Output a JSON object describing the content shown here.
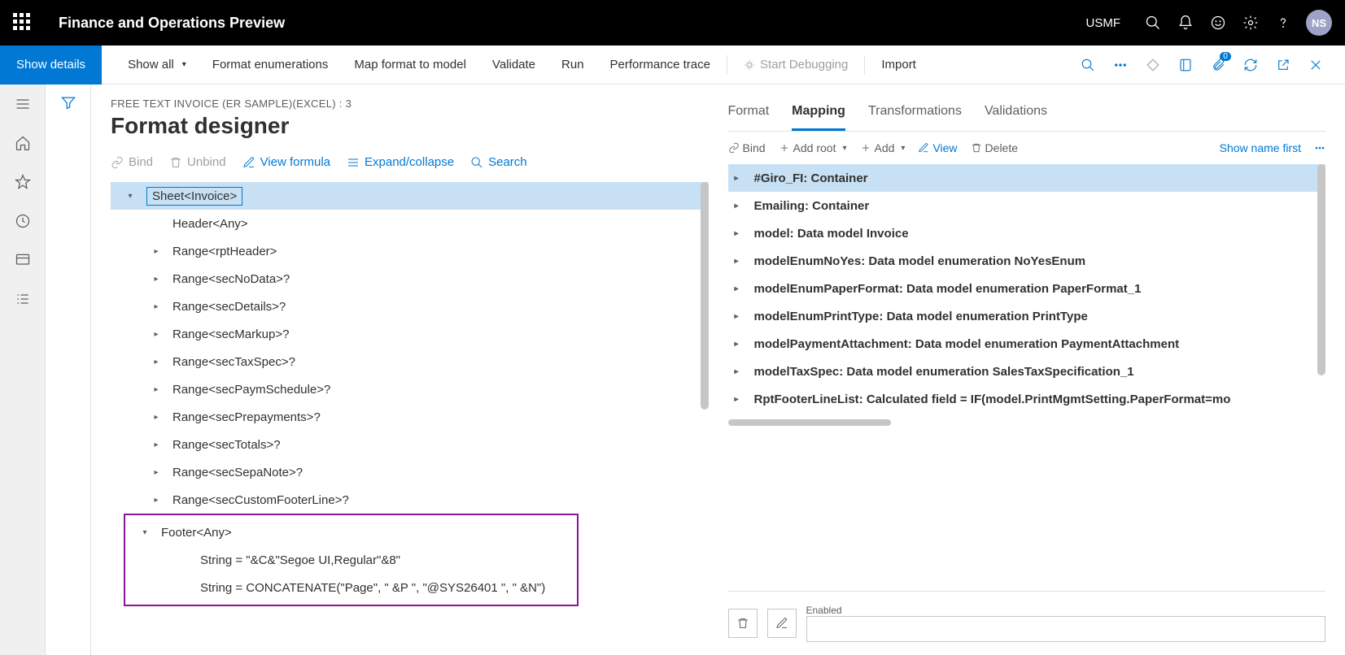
{
  "topbar": {
    "title": "Finance and Operations Preview",
    "company": "USMF",
    "avatar": "NS"
  },
  "actionbar": {
    "primary": "Show details",
    "showAll": "Show all",
    "formatEnum": "Format enumerations",
    "mapFormat": "Map format to model",
    "validate": "Validate",
    "run": "Run",
    "perfTrace": "Performance trace",
    "startDebug": "Start Debugging",
    "import": "Import",
    "attachBadge": "0"
  },
  "page": {
    "breadcrumb": "FREE TEXT INVOICE (ER SAMPLE)(EXCEL) : 3",
    "title": "Format designer"
  },
  "leftToolbar": {
    "bind": "Bind",
    "unbind": "Unbind",
    "viewFormula": "View formula",
    "expand": "Expand/collapse",
    "search": "Search"
  },
  "tree": {
    "root": "Sheet<Invoice>",
    "items": [
      "Header<Any>",
      "Range<rptHeader>",
      "Range<secNoData>?",
      "Range<secDetails>?",
      "Range<secMarkup>?",
      "Range<secTaxSpec>?",
      "Range<secPaymSchedule>?",
      "Range<secPrepayments>?",
      "Range<secTotals>?",
      "Range<secSepaNote>?",
      "Range<secCustomFooterLine>?"
    ],
    "footer": {
      "node": "Footer<Any>",
      "s1": "String = \"&C&\"Segoe UI,Regular\"&8\"",
      "s2": "String = CONCATENATE(\"Page\", \" &P \", \"@SYS26401 \", \" &N\")"
    }
  },
  "tabs": {
    "format": "Format",
    "mapping": "Mapping",
    "transformations": "Transformations",
    "validations": "Validations"
  },
  "mapToolbar": {
    "bind": "Bind",
    "addRoot": "Add root",
    "add": "Add",
    "view": "View",
    "delete": "Delete",
    "showNameFirst": "Show name first"
  },
  "mapTree": [
    "#Giro_FI: Container",
    "Emailing: Container",
    "model: Data model Invoice",
    "modelEnumNoYes: Data model enumeration NoYesEnum",
    "modelEnumPaperFormat: Data model enumeration PaperFormat_1",
    "modelEnumPrintType: Data model enumeration PrintType",
    "modelPaymentAttachment: Data model enumeration PaymentAttachment",
    "modelTaxSpec: Data model enumeration SalesTaxSpecification_1",
    "RptFooterLineList: Calculated field = IF(model.PrintMgmtSetting.PaperFormat=mo"
  ],
  "footerField": {
    "label": "Enabled"
  }
}
